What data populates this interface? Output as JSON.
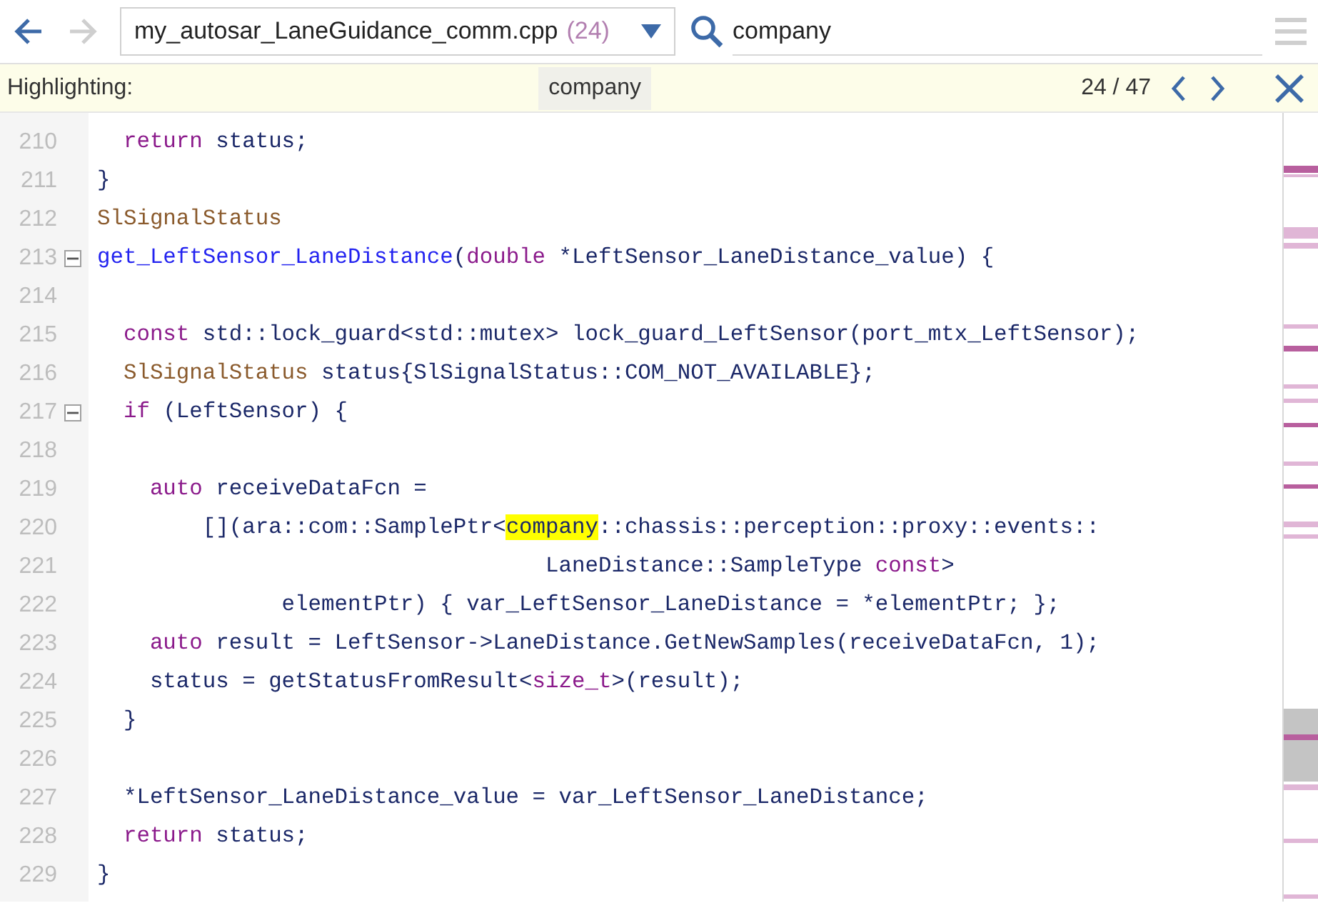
{
  "toolbar": {
    "file": {
      "name": "my_autosar_LaneGuidance_comm.cpp",
      "count": "(24)"
    },
    "search": {
      "value": "company"
    }
  },
  "highlight_bar": {
    "label": "Highlighting:",
    "term": "company",
    "position": "24 / 47"
  },
  "code": [
    {
      "number": "210",
      "foldable": false,
      "tokens": [
        {
          "kind": "keyword",
          "text": "  return"
        },
        {
          "kind": "plain",
          "text": " status;"
        }
      ]
    },
    {
      "number": "211",
      "foldable": false,
      "tokens": [
        {
          "kind": "plain",
          "text": "}"
        }
      ]
    },
    {
      "number": "212",
      "foldable": false,
      "tokens": [
        {
          "kind": "type",
          "text": "SlSignalStatus"
        }
      ]
    },
    {
      "number": "213",
      "foldable": true,
      "tokens": [
        {
          "kind": "function",
          "text": "get_LeftSensor_LaneDistance"
        },
        {
          "kind": "plain",
          "text": "("
        },
        {
          "kind": "keyword",
          "text": "double"
        },
        {
          "kind": "plain",
          "text": " *LeftSensor_LaneDistance_value) {"
        }
      ]
    },
    {
      "number": "214",
      "foldable": false
    },
    {
      "number": "215",
      "foldable": false,
      "tokens": [
        {
          "kind": "keyword",
          "text": "  const"
        },
        {
          "kind": "plain",
          "text": " std::lock_guard<std::mutex> lock_guard_LeftSensor(port_mtx_LeftSensor);"
        }
      ]
    },
    {
      "number": "216",
      "foldable": false,
      "tokens": [
        {
          "kind": "type",
          "text": "  SlSignalStatus"
        },
        {
          "kind": "plain",
          "text": " status{SlSignalStatus::COM_NOT_AVAILABLE};"
        }
      ]
    },
    {
      "number": "217",
      "foldable": true,
      "tokens": [
        {
          "kind": "keyword",
          "text": "  if"
        },
        {
          "kind": "plain",
          "text": " (LeftSensor) {"
        }
      ]
    },
    {
      "number": "218",
      "foldable": false
    },
    {
      "number": "219",
      "foldable": false,
      "tokens": [
        {
          "kind": "keyword",
          "text": "    auto"
        },
        {
          "kind": "plain",
          "text": " receiveDataFcn ="
        }
      ]
    },
    {
      "number": "220",
      "foldable": false,
      "tokens": [
        {
          "kind": "plain",
          "text": "        [](ara::com::SamplePtr<"
        },
        {
          "kind": "match",
          "text": "company"
        },
        {
          "kind": "plain",
          "text": "::chassis::perception::proxy::events::"
        }
      ]
    },
    {
      "number": "221",
      "foldable": false,
      "tokens": [
        {
          "kind": "plain",
          "text": "                                  LaneDistance::SampleType "
        },
        {
          "kind": "keyword",
          "text": "const"
        },
        {
          "kind": "plain",
          "text": ">"
        }
      ]
    },
    {
      "number": "222",
      "foldable": false,
      "tokens": [
        {
          "kind": "plain",
          "text": "              elementPtr) { var_LeftSensor_LaneDistance = *elementPtr; };"
        }
      ]
    },
    {
      "number": "223",
      "foldable": false,
      "tokens": [
        {
          "kind": "keyword",
          "text": "    auto"
        },
        {
          "kind": "plain",
          "text": " result = LeftSensor->LaneDistance.GetNewSamples(receiveDataFcn, 1);"
        }
      ]
    },
    {
      "number": "224",
      "foldable": false,
      "tokens": [
        {
          "kind": "plain",
          "text": "    status = getStatusFromResult<"
        },
        {
          "kind": "keyword",
          "text": "size_t"
        },
        {
          "kind": "plain",
          "text": ">(result);"
        }
      ]
    },
    {
      "number": "225",
      "foldable": false,
      "tokens": [
        {
          "kind": "plain",
          "text": "  }"
        }
      ]
    },
    {
      "number": "226",
      "foldable": false
    },
    {
      "number": "227",
      "foldable": false,
      "tokens": [
        {
          "kind": "plain",
          "text": "  *LeftSensor_LaneDistance_value = var_LeftSensor_LaneDistance;"
        }
      ]
    },
    {
      "number": "228",
      "foldable": false,
      "tokens": [
        {
          "kind": "keyword",
          "text": "  return"
        },
        {
          "kind": "plain",
          "text": " status;"
        }
      ]
    },
    {
      "number": "229",
      "foldable": false,
      "tokens": [
        {
          "kind": "plain",
          "text": "}"
        }
      ]
    }
  ]
}
